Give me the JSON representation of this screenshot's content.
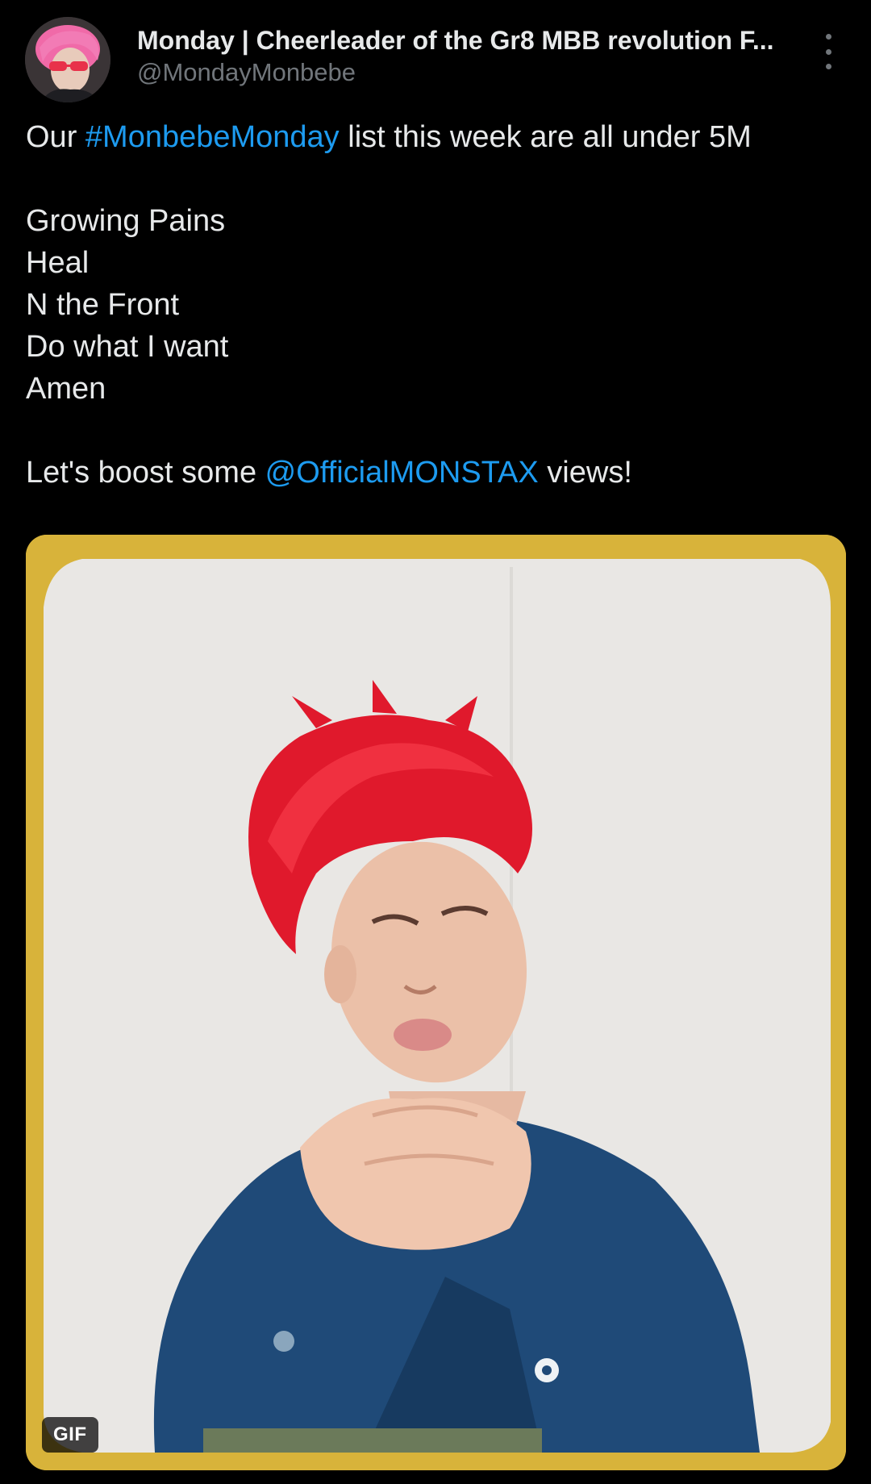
{
  "author": {
    "display_name": "Monday | Cheerleader of the Gr8 MBB revolution F...",
    "handle": "@MondayMonbebe",
    "avatar_icon": "profile-avatar"
  },
  "menu": {
    "icon": "more-options-icon"
  },
  "tweet": {
    "line1_prefix": "Our ",
    "hashtag": "#MonbebeMonday",
    "line1_suffix": " list this week are all under 5M",
    "songs": [
      "Growing Pains",
      "Heal",
      "N the Front",
      "Do what I want",
      "Amen"
    ],
    "line_last_prefix": "Let's boost some ",
    "mention": "@OfficialMONSTAX",
    "line_last_suffix": " views!"
  },
  "media": {
    "badge": "GIF"
  },
  "colors": {
    "background": "#000000",
    "text": "#e7e9ea",
    "secondary": "#71767b",
    "link": "#1d9bf0",
    "media_frame": "#d8b33a"
  }
}
